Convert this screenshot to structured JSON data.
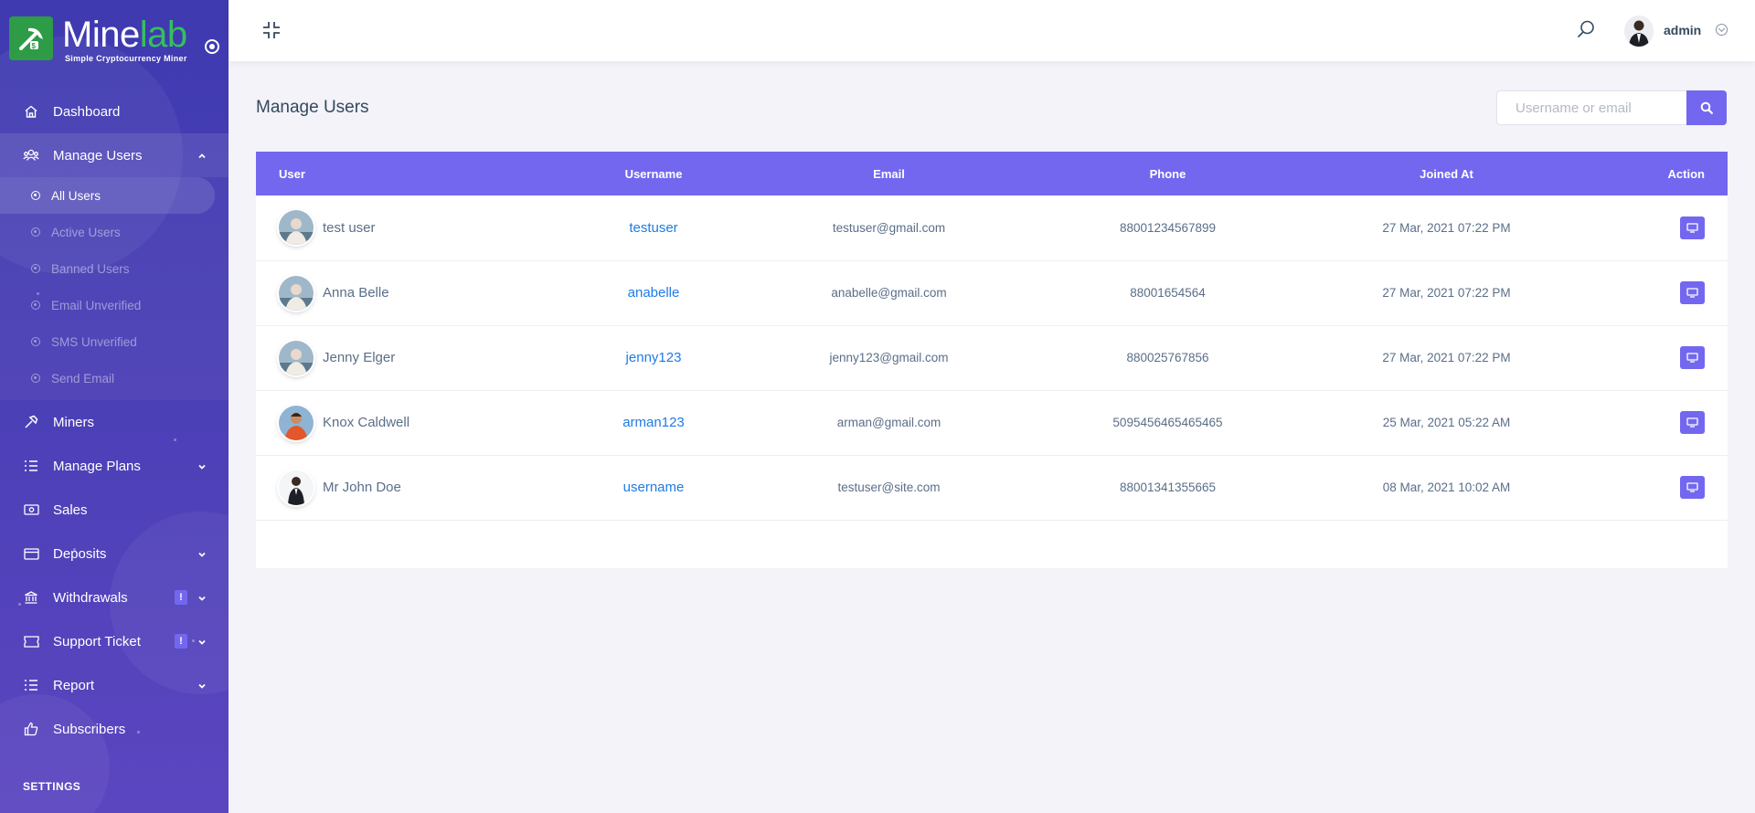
{
  "brand": {
    "name_part1": "Mine",
    "name_part2": "lab",
    "tagline": "Simple Cryptocurrency Miner"
  },
  "sidebar": {
    "items": [
      {
        "label": "Dashboard",
        "icon": "home-icon"
      },
      {
        "label": "Manage Users",
        "icon": "users-icon",
        "open": true
      },
      {
        "label": "Miners",
        "icon": "hammer-icon"
      },
      {
        "label": "Manage Plans",
        "icon": "list-icon"
      },
      {
        "label": "Sales",
        "icon": "money-icon"
      },
      {
        "label": "Deposits",
        "icon": "credit-card-icon"
      },
      {
        "label": "Withdrawals",
        "icon": "bank-icon",
        "badge": "!"
      },
      {
        "label": "Support Ticket",
        "icon": "ticket-icon",
        "badge": "!"
      },
      {
        "label": "Report",
        "icon": "list-icon"
      },
      {
        "label": "Subscribers",
        "icon": "thumbs-up-icon"
      }
    ],
    "submenu": [
      "All Users",
      "Active Users",
      "Banned Users",
      "Email Unverified",
      "SMS Unverified",
      "Send Email"
    ],
    "settings_title": "SETTINGS"
  },
  "topbar": {
    "admin_name": "admin"
  },
  "main": {
    "title": "Manage Users",
    "search_placeholder": "Username or email",
    "columns": [
      "User",
      "Username",
      "Email",
      "Phone",
      "Joined At",
      "Action"
    ],
    "rows": [
      {
        "name": "test user",
        "username": "testuser",
        "email": "testuser@gmail.com",
        "phone": "88001234567899",
        "joined": "27 Mar, 2021 07:22 PM"
      },
      {
        "name": "Anna Belle",
        "username": "anabelle",
        "email": "anabelle@gmail.com",
        "phone": "88001654564",
        "joined": "27 Mar, 2021 07:22 PM"
      },
      {
        "name": "Jenny Elger",
        "username": "jenny123",
        "email": "jenny123@gmail.com",
        "phone": "880025767856",
        "joined": "27 Mar, 2021 07:22 PM"
      },
      {
        "name": "Knox Caldwell",
        "username": "arman123",
        "email": "arman@gmail.com",
        "phone": "5095456465465465",
        "joined": "25 Mar, 2021 05:22 AM"
      },
      {
        "name": "Mr John Doe",
        "username": "username",
        "email": "testuser@site.com",
        "phone": "88001341355665",
        "joined": "08 Mar, 2021 10:02 AM"
      }
    ]
  },
  "colors": {
    "accent": "#7367f0",
    "sidebar": "#4a3fb6",
    "brand_green": "#2e9b47",
    "link": "#1e7be6"
  }
}
